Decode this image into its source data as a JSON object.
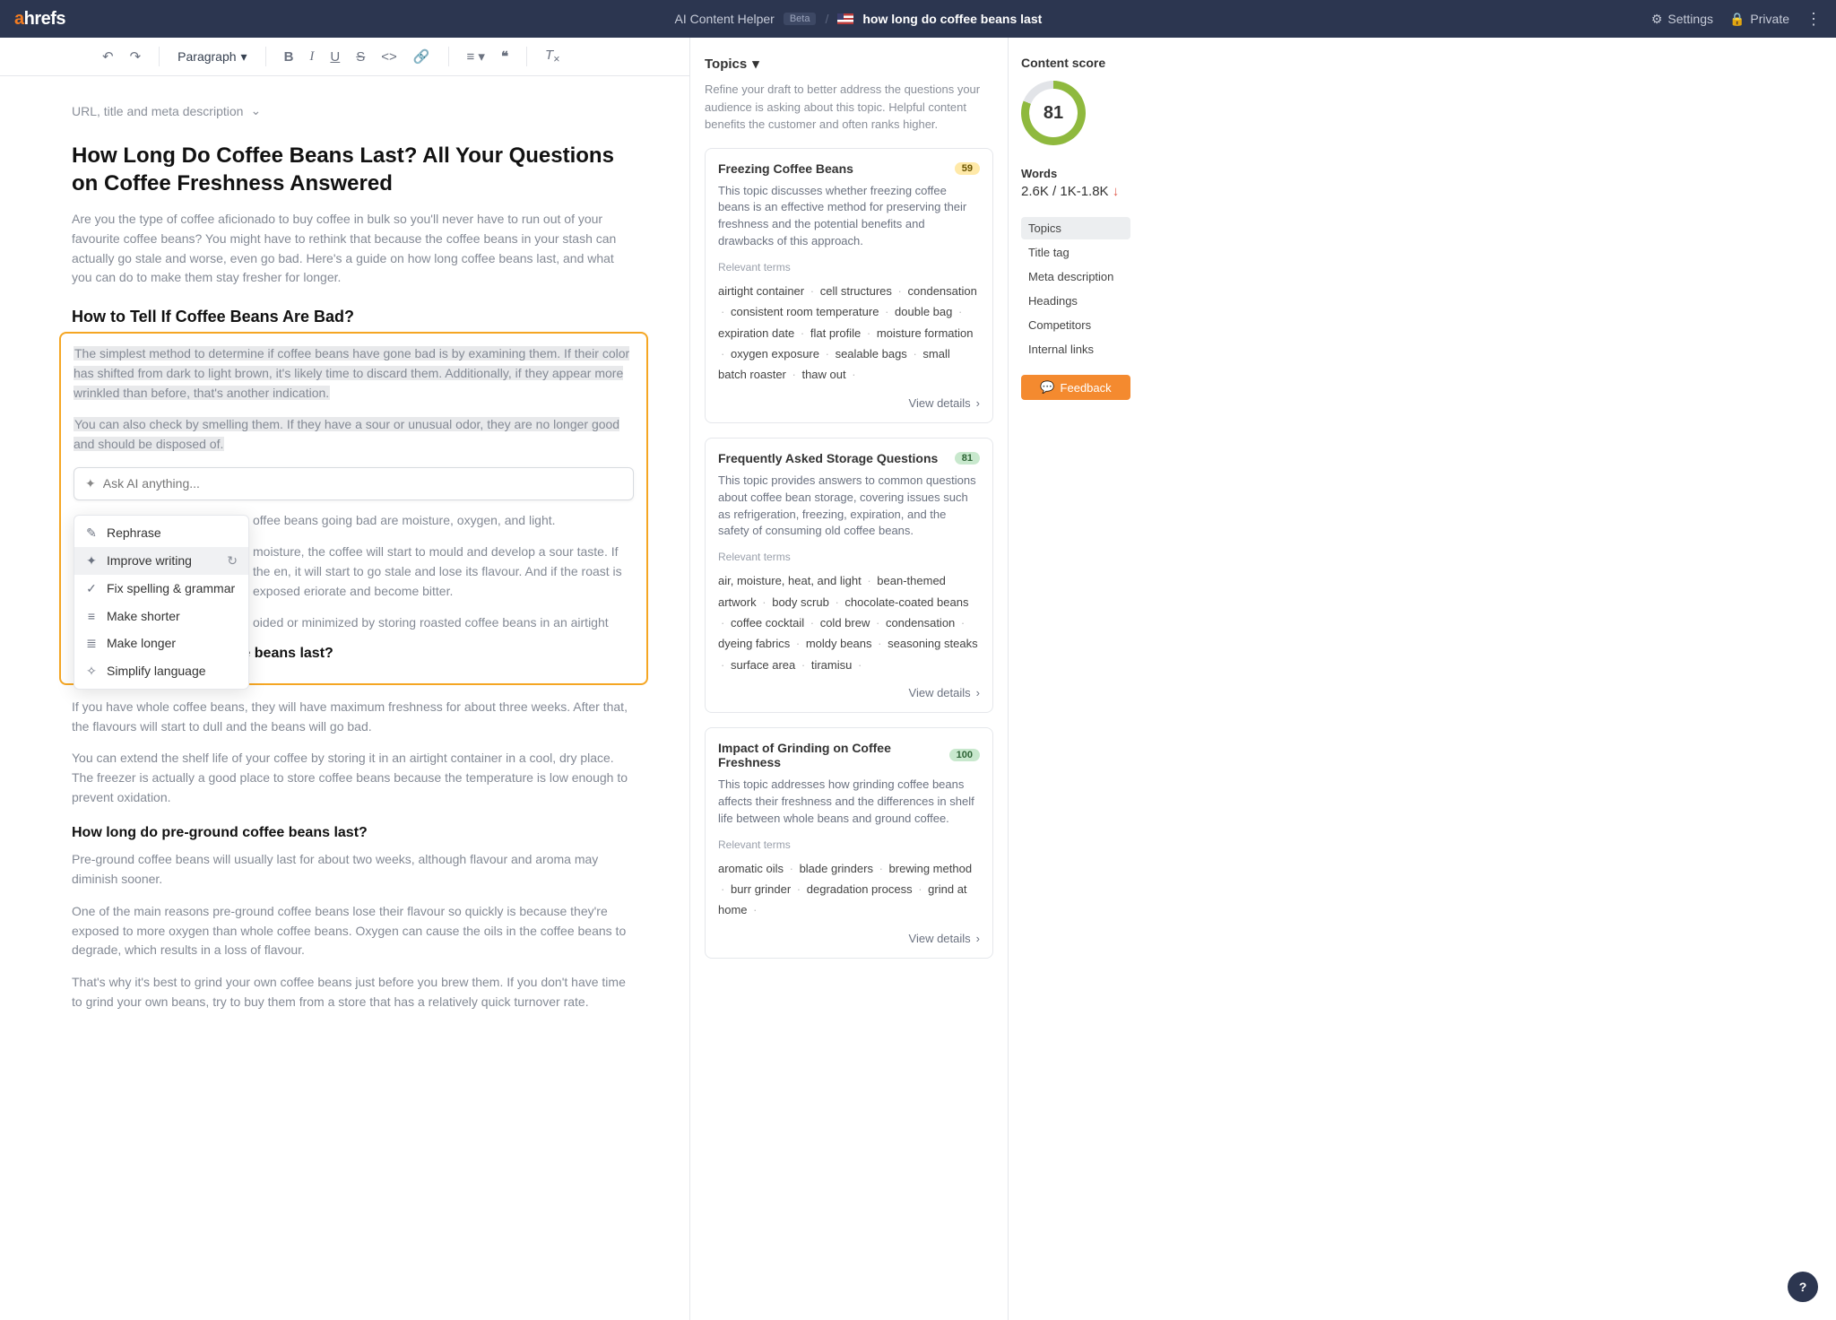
{
  "header": {
    "app_name": "AI Content Helper",
    "beta": "Beta",
    "query": "how long do coffee beans last",
    "settings": "Settings",
    "private": "Private"
  },
  "toolbar": {
    "paragraph": "Paragraph"
  },
  "meta_row": "URL, title and meta description",
  "title": "How Long Do Coffee Beans Last? All Your Questions on Coffee Freshness Answered",
  "intro": "Are you the type of coffee aficionado to buy coffee in bulk so you'll never have to run out of your favourite coffee beans? You might have to rethink that because the coffee beans in your stash can actually go stale and worse, even go bad. Here's a guide on how long coffee beans last, and what you can do to make them stay fresher for longer.",
  "h2_1": "How to Tell If Coffee Beans Are Bad?",
  "hl1": "The simplest method to determine if coffee beans have gone bad is by examining them. If their color has shifted from dark to light brown, it's likely time to discard them. Additionally, if they appear more wrinkled than before, that's another indication.",
  "hl2": "You can also check by smelling them. If they have a sour or unusual odor, they are no longer good and should be disposed of.",
  "ai_placeholder": "Ask AI anything...",
  "ai_menu": {
    "rephrase": "Rephrase",
    "improve": "Improve writing",
    "fix": "Fix spelling & grammar",
    "shorter": "Make shorter",
    "longer": "Make longer",
    "simplify": "Simplify language"
  },
  "p_behind1": "offee beans going bad are moisture, oxygen, and light.",
  "p_behind2": "moisture, the coffee will start to mould and develop a sour taste. If the en, it will start to go stale and lose its flavour. And if the roast is exposed eriorate and become bitter.",
  "p_behind3": "oided or minimized by storing roasted coffee beans in an airtight",
  "h3_1": "How long do whole coffee beans last?",
  "p3a": "If you have whole coffee beans, they will have maximum freshness for about three weeks. After that, the flavours will start to dull and the beans will go bad.",
  "p3b": "You can extend the shelf life of your coffee by storing it in an airtight container in a cool, dry place. The freezer is actually a good place to store coffee beans because the temperature is low enough to prevent oxidation.",
  "h3_2": "How long do pre-ground coffee beans last?",
  "p4a": "Pre-ground coffee beans will usually last for about two weeks, although flavour and aroma may diminish sooner.",
  "p4b": "One of the main reasons pre-ground coffee beans lose their flavour so quickly is because they're exposed to more oxygen than whole coffee beans. Oxygen can cause the oils in the coffee beans to degrade, which results in a loss of flavour.",
  "p4c": "That's why it's best to grind your own coffee beans just before you brew them. If you don't have time to grind your own beans, try to buy them from a store that has a relatively quick turnover rate.",
  "side": {
    "title": "Topics",
    "desc": "Refine your draft to better address the questions your audience is asking about this topic. Helpful content benefits the customer and often ranks higher.",
    "relevant_label": "Relevant terms",
    "view_details": "View details"
  },
  "topics": [
    {
      "title": "Freezing Coffee Beans",
      "score": "59",
      "score_class": "sb-yellow",
      "desc": "This topic discusses whether freezing coffee beans is an effective method for preserving their freshness and the potential benefits and drawbacks of this approach.",
      "terms": [
        "airtight container",
        "cell structures",
        "condensation",
        "consistent room temperature",
        "double bag",
        "expiration date",
        "flat profile",
        "moisture formation",
        "oxygen exposure",
        "sealable bags",
        "small batch roaster",
        "thaw out"
      ]
    },
    {
      "title": "Frequently Asked Storage Questions",
      "score": "81",
      "score_class": "sb-green",
      "desc": "This topic provides answers to common questions about coffee bean storage, covering issues such as refrigeration, freezing, expiration, and the safety of consuming old coffee beans.",
      "terms": [
        "air, moisture, heat, and light",
        "bean-themed artwork",
        "body scrub",
        "chocolate-coated beans",
        "coffee cocktail",
        "cold brew",
        "condensation",
        "dyeing fabrics",
        "moldy beans",
        "seasoning steaks",
        "surface area",
        "tiramisu"
      ]
    },
    {
      "title": "Impact of Grinding on Coffee Freshness",
      "score": "100",
      "score_class": "sb-green",
      "desc": "This topic addresses how grinding coffee beans affects their freshness and the differences in shelf life between whole beans and ground coffee.",
      "terms": [
        "aromatic oils",
        "blade grinders",
        "brewing method",
        "burr grinder",
        "degradation process",
        "grind at home"
      ]
    }
  ],
  "right": {
    "cs_label": "Content score",
    "score": "81",
    "words_label": "Words",
    "words_val": "2.6K / 1K-1.8K",
    "nav": [
      "Topics",
      "Title tag",
      "Meta description",
      "Headings",
      "Competitors",
      "Internal links"
    ],
    "feedback": "Feedback"
  }
}
